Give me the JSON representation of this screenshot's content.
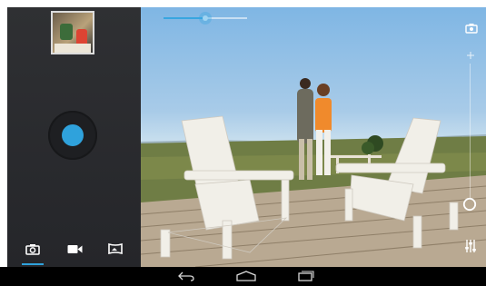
{
  "camera": {
    "zoom_fraction": 0.5,
    "selected_mode": "photo",
    "modes": [
      {
        "id": "photo",
        "icon": "camera-icon"
      },
      {
        "id": "video",
        "icon": "video-icon"
      },
      {
        "id": "panorama",
        "icon": "panorama-icon"
      }
    ],
    "shutter_color": "#2fa2dc",
    "accent_color": "#38a6e0"
  },
  "controls": {
    "switch_camera_icon": "switch-camera-icon",
    "zoom_in_icon": "plus-icon",
    "settings_icon": "settings-sliders-icon",
    "ring_icon": "circle-ring-icon"
  },
  "navbar": {
    "back_icon": "back-icon",
    "home_icon": "home-icon",
    "recent_icon": "recent-apps-icon"
  }
}
